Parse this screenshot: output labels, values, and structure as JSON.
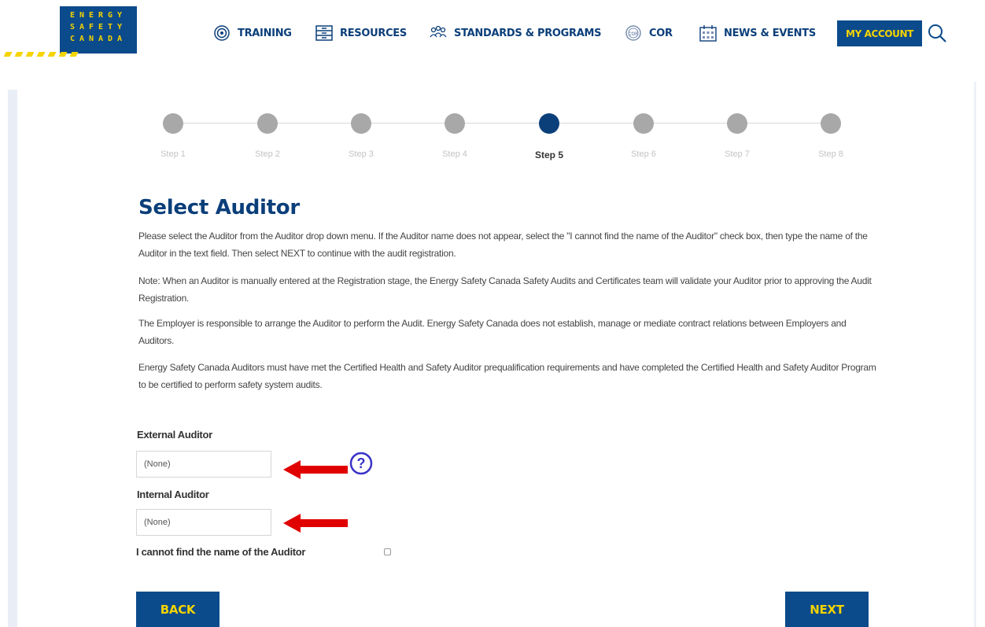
{
  "brand": {
    "logo_lines": [
      "ENERGY",
      "SAFETY",
      "CANADA"
    ],
    "colors": {
      "primary": "#0b4a8b",
      "accent": "#f5d400",
      "title": "#0b3f7a",
      "arrow": "#e00000",
      "help": "#3a33c8"
    }
  },
  "nav": {
    "items": [
      {
        "label": "TRAINING",
        "icon": "target-icon"
      },
      {
        "label": "RESOURCES",
        "icon": "cabinet-icon"
      },
      {
        "label": "STANDARDS & PROGRAMS",
        "icon": "people-icon"
      },
      {
        "label": "COR",
        "icon": "badge-icon"
      },
      {
        "label": "NEWS & EVENTS",
        "icon": "calendar-icon"
      }
    ],
    "account_label": "MY ACCOUNT",
    "search_icon": "search-icon"
  },
  "stepper": {
    "steps": [
      "Step 1",
      "Step 2",
      "Step 3",
      "Step 4",
      "Step 5",
      "Step 6",
      "Step 7",
      "Step 8"
    ],
    "active_index": 4
  },
  "page": {
    "title": "Select Auditor",
    "paragraphs": [
      "Please select the Auditor from the Auditor drop down menu. If the Auditor name does not appear, select the \"I cannot find the name of the Auditor\" check box, then type the name of the Auditor in the text field. Then select NEXT to continue with the audit registration.",
      "Note: When an Auditor is manually entered at the Registration stage, the Energy Safety Canada Safety Audits and Certificates team will validate your Auditor prior to approving the Audit Registration.",
      "The Employer is responsible to arrange the Auditor to perform the Audit. Energy Safety Canada does not establish, manage or mediate contract relations between Employers and Auditors.",
      "Energy Safety Canada Auditors must have met the Certified Health and Safety Auditor prequalification requirements and have completed the Certified Health and Safety Auditor Program to be certified to perform safety system audits."
    ]
  },
  "form": {
    "external_label": "External Auditor",
    "external_value": "(None)",
    "internal_label": "Internal Auditor",
    "internal_value": "(None)",
    "help_glyph": "?",
    "checkbox_label": "I cannot find the name of the Auditor",
    "checkbox_checked": false
  },
  "buttons": {
    "back": "BACK",
    "next": "NEXT"
  }
}
